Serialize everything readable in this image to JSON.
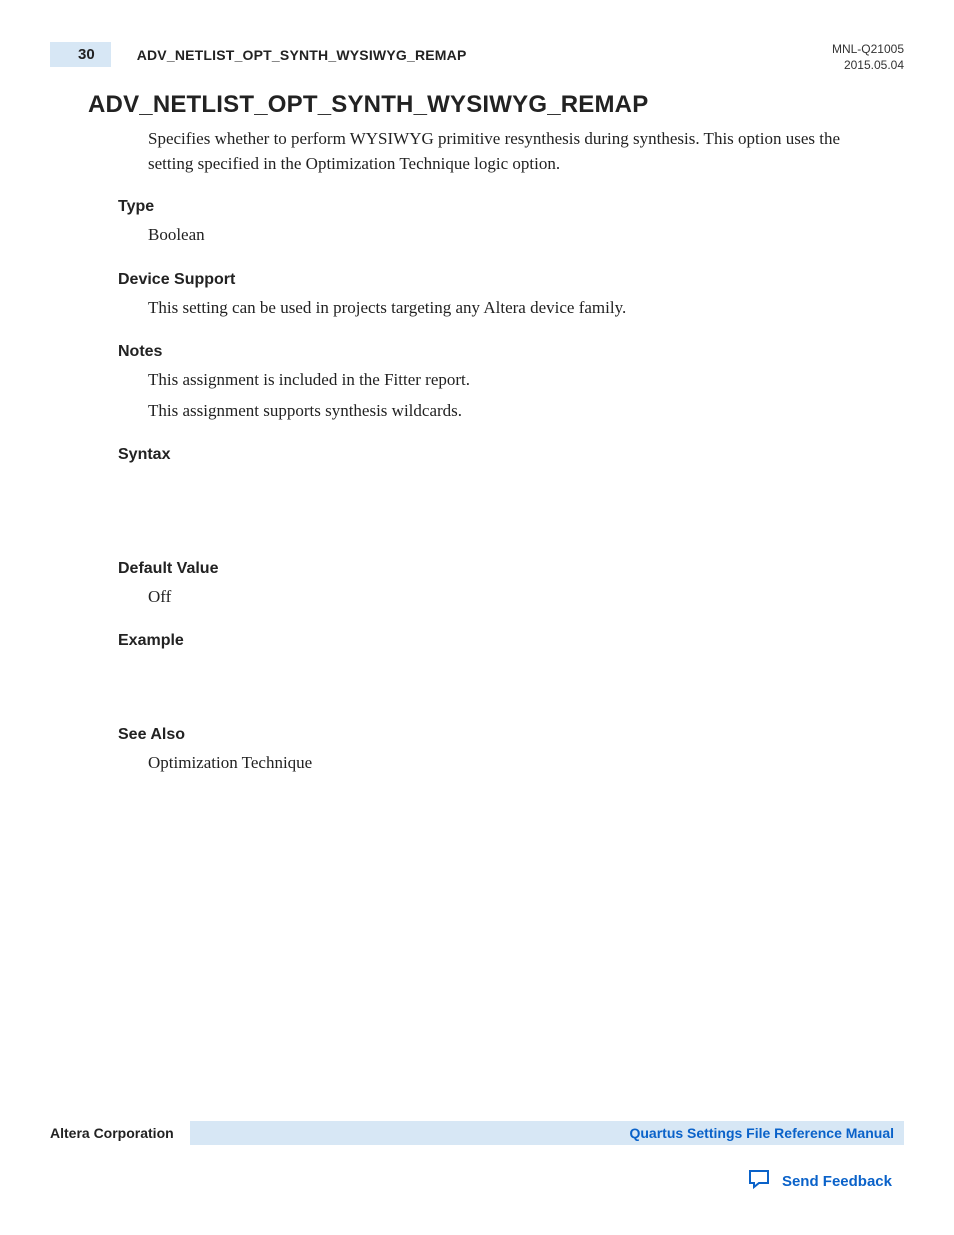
{
  "header": {
    "page_number": "30",
    "running_title": "ADV_NETLIST_OPT_SYNTH_WYSIWYG_REMAP",
    "doc_id": "MNL-Q21005",
    "date": "2015.05.04"
  },
  "title": "ADV_NETLIST_OPT_SYNTH_WYSIWYG_REMAP",
  "intro": "Specifies whether to perform WYSIWYG primitive resynthesis during synthesis. This option uses the setting specified in the Optimization Technique logic option.",
  "sections": {
    "type": {
      "heading": "Type",
      "body": "Boolean"
    },
    "device_support": {
      "heading": "Device Support",
      "body": "This setting can be used in projects targeting any Altera device family."
    },
    "notes": {
      "heading": "Notes",
      "line1": "This assignment is included in the Fitter report.",
      "line2": "This assignment supports synthesis wildcards."
    },
    "syntax": {
      "heading": "Syntax"
    },
    "default_value": {
      "heading": "Default Value",
      "body": "Off"
    },
    "example": {
      "heading": "Example"
    },
    "see_also": {
      "heading": "See Also",
      "body": "Optimization Technique"
    }
  },
  "footer": {
    "company": "Altera Corporation",
    "manual_link": "Quartus Settings File Reference Manual",
    "feedback": "Send Feedback"
  }
}
